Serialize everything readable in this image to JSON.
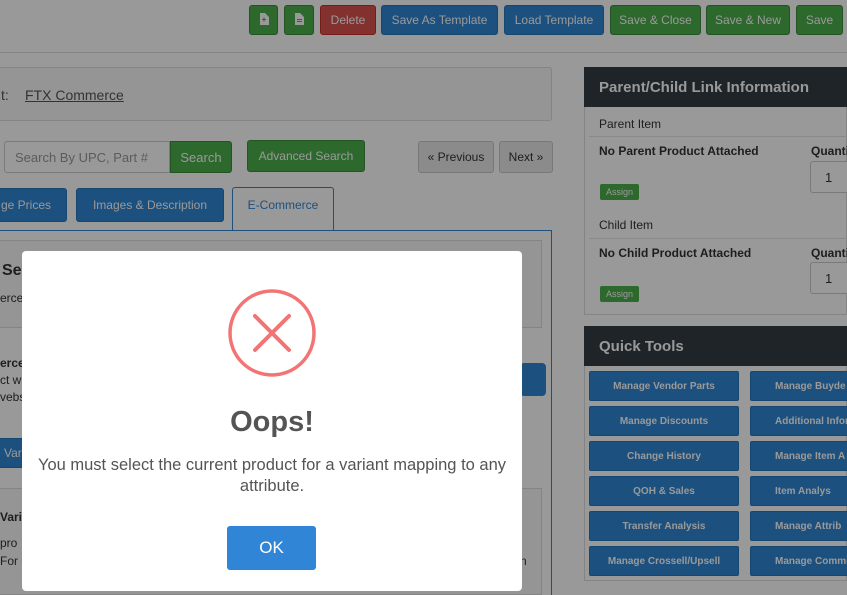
{
  "toolbar": {
    "delete": "Delete",
    "save_as_template": "Save As Template",
    "load_template": "Load Template",
    "save_close": "Save & Close",
    "save_new": "Save & New",
    "save": "Save"
  },
  "account": {
    "label": "t:",
    "value": "FTX Commerce"
  },
  "search": {
    "placeholder": "Search By UPC, Part #",
    "button": "Search",
    "advanced": "Advanced Search"
  },
  "pagination": {
    "previous": "« Previous",
    "next": "Next »"
  },
  "tabs": [
    {
      "label": "ge Prices"
    },
    {
      "label": "Images & Description"
    },
    {
      "label": "E-Commerce"
    }
  ],
  "background_fragments": {
    "heading": "Se",
    "line1": "erce",
    "line2": "erce",
    "line3": "ct w",
    "line4": "vebs",
    "tab": "Var",
    "section": "Vari",
    "pro": "pro",
    "for": "For c",
    "n": "n"
  },
  "parent_child": {
    "title": "Parent/Child Link Information",
    "parent_label": "Parent Item",
    "parent_value": "No Parent Product Attached",
    "child_label": "Child Item",
    "child_value": "No Child Product Attached",
    "quantity_label": "Quanti",
    "parent_qty": "1",
    "child_qty": "1",
    "assign": "Assign"
  },
  "quick_tools": {
    "title": "Quick Tools",
    "left": [
      "Manage Vendor Parts",
      "Manage Discounts",
      "Change History",
      "QOH & Sales",
      "Transfer Analysis",
      "Manage Crossell/Upsell"
    ],
    "right": [
      "Manage Buyde",
      "Additional Infor",
      "Manage Item A",
      "Item Analys",
      "Manage Attrib",
      "Manage Commi"
    ]
  },
  "dialog": {
    "title": "Oops!",
    "message": "You must select the current product for a variant mapping to any attribute.",
    "ok": "OK",
    "icon": "error-x-icon",
    "icon_color": "#f27474",
    "ok_color": "#3085d6"
  }
}
